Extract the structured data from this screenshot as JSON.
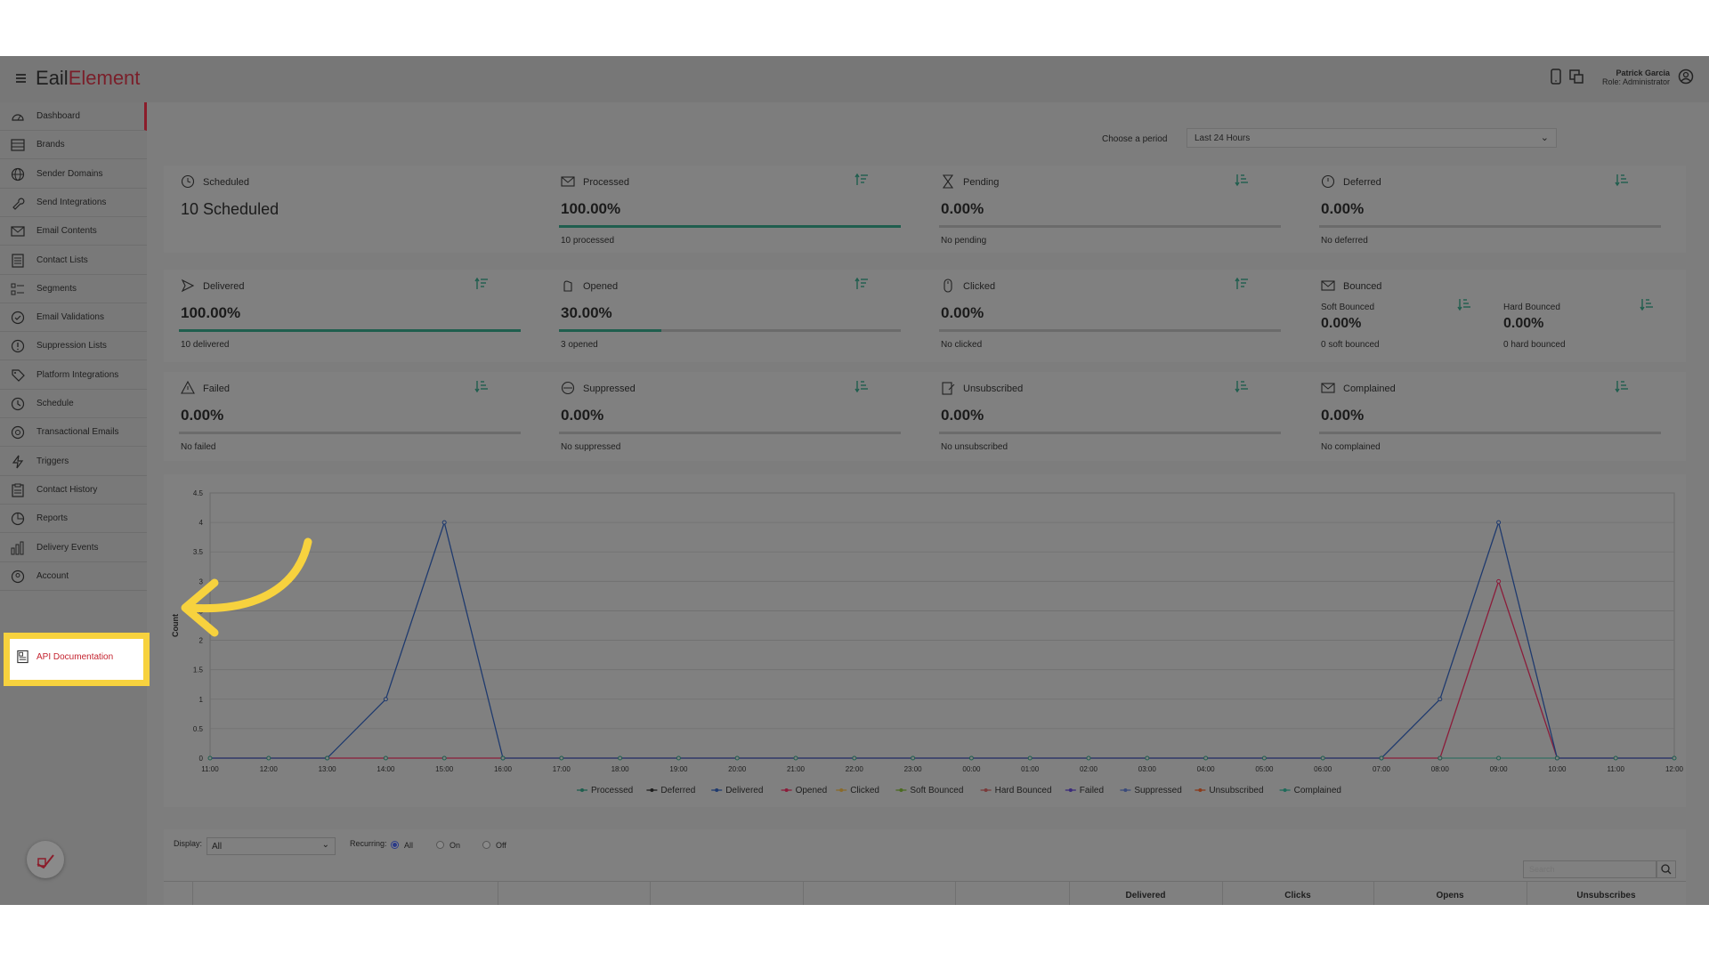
{
  "app": {
    "logo_prefix": "E",
    "logo_mid": "ail",
    "logo_suffix": "Element"
  },
  "user": {
    "name": "Patrick Garcia",
    "role": "Role: Administrator"
  },
  "sidebar": {
    "items": [
      {
        "label": "Dashboard",
        "icon": "dashboard-icon"
      },
      {
        "label": "Brands",
        "icon": "brands-icon"
      },
      {
        "label": "Sender Domains",
        "icon": "globe-icon"
      },
      {
        "label": "Send Integrations",
        "icon": "wrench-icon"
      },
      {
        "label": "Email Contents",
        "icon": "envelope-icon"
      },
      {
        "label": "Contact Lists",
        "icon": "list-icon"
      },
      {
        "label": "Segments",
        "icon": "segments-icon"
      },
      {
        "label": "Email Validations",
        "icon": "check-circle-icon"
      },
      {
        "label": "Suppression Lists",
        "icon": "alert-circle-icon"
      },
      {
        "label": "Platform Integrations",
        "icon": "tag-icon"
      },
      {
        "label": "Schedule",
        "icon": "clock-icon"
      },
      {
        "label": "Transactional Emails",
        "icon": "at-icon"
      },
      {
        "label": "Triggers",
        "icon": "lightning-icon"
      },
      {
        "label": "Contact History",
        "icon": "clipboard-icon"
      },
      {
        "label": "Reports",
        "icon": "pie-chart-icon"
      },
      {
        "label": "Delivery Events",
        "icon": "bar-chart-icon"
      },
      {
        "label": "Account",
        "icon": "account-icon"
      },
      {
        "label": "API Documentation",
        "icon": "document-icon"
      }
    ]
  },
  "period": {
    "label": "Choose a period",
    "value": "Last 24 Hours"
  },
  "cards": {
    "scheduled": {
      "title": "Scheduled",
      "value": "10 Scheduled"
    },
    "processed": {
      "title": "Processed",
      "value": "100.00%",
      "foot": "10 processed",
      "progress": 1.0
    },
    "pending": {
      "title": "Pending",
      "value": "0.00%",
      "foot": "No pending",
      "progress": 0
    },
    "deferred": {
      "title": "Deferred",
      "value": "0.00%",
      "foot": "No deferred",
      "progress": 0
    },
    "delivered": {
      "title": "Delivered",
      "value": "100.00%",
      "foot": "10 delivered",
      "progress": 1.0
    },
    "opened": {
      "title": "Opened",
      "value": "30.00%",
      "foot": "3 opened",
      "progress": 0.3
    },
    "clicked": {
      "title": "Clicked",
      "value": "0.00%",
      "foot": "No clicked",
      "progress": 0
    },
    "bounced": {
      "title": "Bounced",
      "soft_label": "Soft Bounced",
      "soft_value": "0.00%",
      "soft_foot": "0 soft bounced",
      "hard_label": "Hard Bounced",
      "hard_value": "0.00%",
      "hard_foot": "0 hard bounced"
    },
    "failed": {
      "title": "Failed",
      "value": "0.00%",
      "foot": "No failed",
      "progress": 0
    },
    "suppressed": {
      "title": "Suppressed",
      "value": "0.00%",
      "foot": "No suppressed",
      "progress": 0
    },
    "unsubscribed": {
      "title": "Unsubscribed",
      "value": "0.00%",
      "foot": "No unsubscribed",
      "progress": 0
    },
    "complained": {
      "title": "Complained",
      "value": "0.00%",
      "foot": "No complained",
      "progress": 0
    }
  },
  "controls": {
    "display_label": "Display:",
    "display_value": "All",
    "recurring_label": "Recurring:",
    "radio_all": "All",
    "radio_on": "On",
    "radio_off": "Off",
    "search_placeholder": "Search",
    "columns": [
      "Delivered",
      "Clicks",
      "Opens",
      "Unsubscribes"
    ]
  },
  "chart_data": {
    "type": "line",
    "title": "",
    "xlabel": "",
    "ylabel": "Count",
    "ylim": [
      0,
      4.5
    ],
    "yticks": [
      0,
      0.5,
      1,
      1.5,
      2,
      2.5,
      3,
      3.5,
      4,
      4.5
    ],
    "grid": true,
    "legend_position": "bottom",
    "x": [
      "11:00",
      "12:00",
      "13:00",
      "14:00",
      "15:00",
      "16:00",
      "17:00",
      "18:00",
      "19:00",
      "20:00",
      "21:00",
      "22:00",
      "23:00",
      "00:00",
      "01:00",
      "02:00",
      "03:00",
      "04:00",
      "05:00",
      "06:00",
      "07:00",
      "08:00",
      "09:00",
      "10:00",
      "11:00",
      "12:00"
    ],
    "series": [
      {
        "name": "Processed",
        "color": "#1f5e4e",
        "values": [
          0,
          0,
          0,
          0,
          0,
          0,
          0,
          0,
          0,
          0,
          0,
          0,
          0,
          0,
          0,
          0,
          0,
          0,
          0,
          0,
          0,
          0,
          0,
          0,
          0,
          0
        ]
      },
      {
        "name": "Deferred",
        "color": "#1d1d1d",
        "values": [
          0,
          0,
          0,
          0,
          0,
          0,
          0,
          0,
          0,
          0,
          0,
          0,
          0,
          0,
          0,
          0,
          0,
          0,
          0,
          0,
          0,
          0,
          0,
          0,
          0,
          0
        ]
      },
      {
        "name": "Delivered",
        "color": "#1f3a6e",
        "values": [
          0,
          0,
          0,
          1,
          4,
          0,
          0,
          0,
          0,
          0,
          0,
          0,
          0,
          0,
          0,
          0,
          0,
          0,
          0,
          0,
          0,
          1,
          4,
          0,
          0,
          0
        ]
      },
      {
        "name": "Opened",
        "color": "#8b1c3a",
        "values": [
          0,
          0,
          0,
          0,
          0,
          0,
          0,
          0,
          0,
          0,
          0,
          0,
          0,
          0,
          0,
          0,
          0,
          0,
          0,
          0,
          0,
          0,
          3,
          0,
          0,
          0
        ]
      },
      {
        "name": "Clicked",
        "color": "#8a6a2a",
        "values": [
          0,
          0,
          0,
          0,
          0,
          0,
          0,
          0,
          0,
          0,
          0,
          0,
          0,
          0,
          0,
          0,
          0,
          0,
          0,
          0,
          0,
          0,
          0,
          0,
          0,
          0
        ]
      },
      {
        "name": "Soft Bounced",
        "color": "#4a6a1f",
        "values": [
          0,
          0,
          0,
          0,
          0,
          0,
          0,
          0,
          0,
          0,
          0,
          0,
          0,
          0,
          0,
          0,
          0,
          0,
          0,
          0,
          0,
          0,
          0,
          0,
          0,
          0
        ]
      },
      {
        "name": "Hard Bounced",
        "color": "#7a3a3a",
        "values": [
          0,
          0,
          0,
          0,
          0,
          0,
          0,
          0,
          0,
          0,
          0,
          0,
          0,
          0,
          0,
          0,
          0,
          0,
          0,
          0,
          0,
          0,
          0,
          0,
          0,
          0
        ]
      },
      {
        "name": "Failed",
        "color": "#3a2a7a",
        "values": [
          0,
          0,
          0,
          0,
          0,
          0,
          0,
          0,
          0,
          0,
          0,
          0,
          0,
          0,
          0,
          0,
          0,
          0,
          0,
          0,
          0,
          0,
          0,
          0,
          0,
          0
        ]
      },
      {
        "name": "Suppressed",
        "color": "#3a4a7a",
        "values": [
          0,
          0,
          0,
          0,
          0,
          0,
          0,
          0,
          0,
          0,
          0,
          0,
          0,
          0,
          0,
          0,
          0,
          0,
          0,
          0,
          0,
          0,
          0,
          0,
          0,
          0
        ]
      },
      {
        "name": "Unsubscribed",
        "color": "#8a3a1a",
        "values": [
          0,
          0,
          0,
          0,
          0,
          0,
          0,
          0,
          0,
          0,
          0,
          0,
          0,
          0,
          0,
          0,
          0,
          0,
          0,
          0,
          0,
          0,
          0,
          0,
          0,
          0
        ]
      },
      {
        "name": "Complained",
        "color": "#1f6a5a",
        "values": [
          0,
          0,
          0,
          0,
          0,
          0,
          0,
          0,
          0,
          0,
          0,
          0,
          0,
          0,
          0,
          0,
          0,
          0,
          0,
          0,
          0,
          0,
          0,
          0,
          0,
          0
        ]
      }
    ]
  }
}
